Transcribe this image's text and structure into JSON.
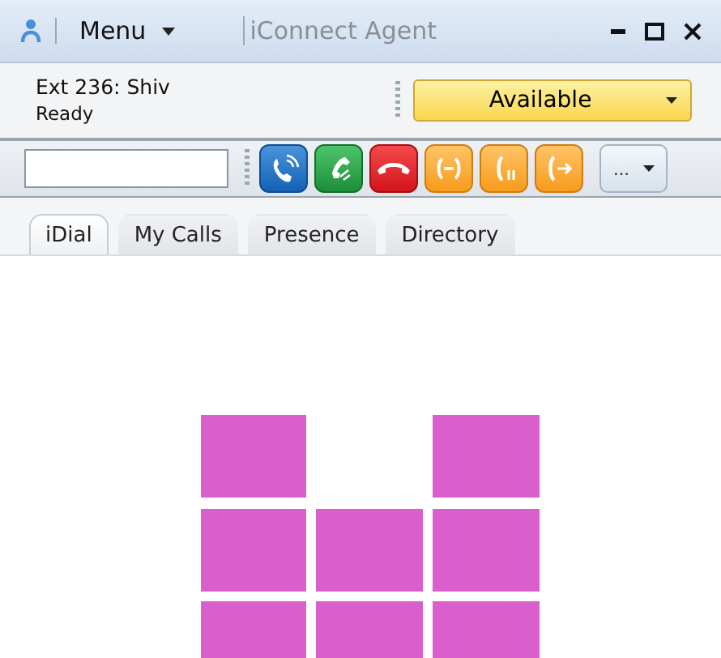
{
  "window": {
    "title": "iConnect Agent",
    "menu": "Menu"
  },
  "agent": {
    "extension": "Ext 236: Shiv",
    "state": "Ready"
  },
  "status_dropdown": {
    "value": "Available"
  },
  "call_buttons": [
    {
      "kind": "dial"
    },
    {
      "kind": "answer"
    },
    {
      "kind": "hangup"
    },
    {
      "kind": "conference"
    },
    {
      "kind": "hold"
    },
    {
      "kind": "transfer"
    }
  ],
  "more_button": {
    "label": "..."
  },
  "tabs": [
    {
      "label": "iDial",
      "selected": true
    },
    {
      "label": "My Calls",
      "selected": false
    },
    {
      "label": "Presence",
      "selected": false
    },
    {
      "label": "Directory",
      "selected": false
    }
  ]
}
